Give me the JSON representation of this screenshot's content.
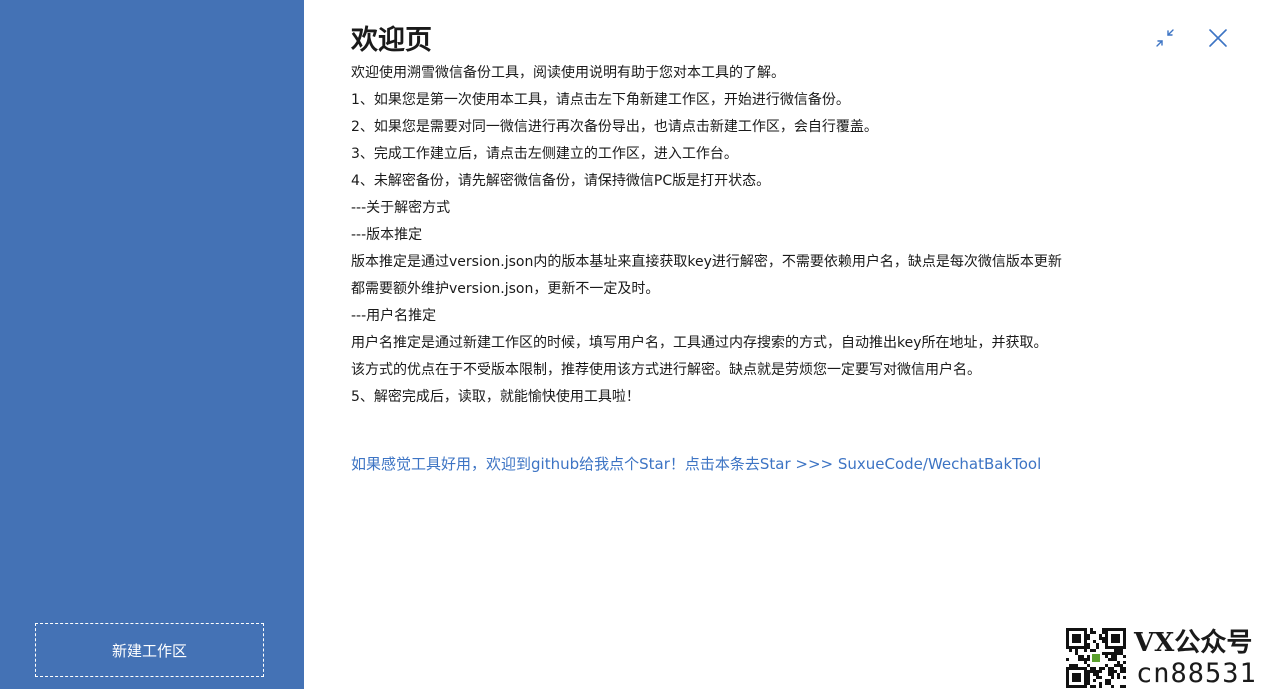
{
  "sidebar": {
    "new_workspace_label": "新建工作区"
  },
  "welcome": {
    "title": "欢迎页",
    "lines": [
      "欢迎使用溯雪微信备份工具，阅读使用说明有助于您对本工具的了解。",
      "1、如果您是第一次使用本工具，请点击左下角新建工作区，开始进行微信备份。",
      "2、如果您是需要对同一微信进行再次备份导出，也请点击新建工作区，会自行覆盖。",
      "3、完成工作建立后，请点击左侧建立的工作区，进入工作台。",
      "4、未解密备份，请先解密微信备份，请保持微信PC版是打开状态。",
      "---关于解密方式",
      "---版本推定",
      "版本推定是通过version.json内的版本基址来直接获取key进行解密，不需要依赖用户名，缺点是每次微信版本更新",
      "都需要额外维护version.json，更新不一定及时。",
      "---用户名推定",
      "用户名推定是通过新建工作区的时候，填写用户名，工具通过内存搜索的方式，自动推出key所在地址，并获取。",
      "该方式的优点在于不受版本限制，推荐使用该方式进行解密。缺点就是劳烦您一定要写对微信用户名。",
      "5、解密完成后，读取，就能愉快使用工具啦！"
    ],
    "star_link": "如果感觉工具好用，欢迎到github给我点个Star！点击本条去Star  >>>  SuxueCode/WechatBakTool"
  },
  "window_controls": {
    "minimize_icon": "shrink-arrows-icon",
    "close_icon": "close-icon"
  },
  "watermark": {
    "line1": "VX公众号",
    "line2": "cn88531"
  },
  "colors": {
    "sidebar_bg": "#4472b5",
    "link": "#3d74c4",
    "text": "#1a1a1a",
    "control_icon": "#3d74c4"
  }
}
